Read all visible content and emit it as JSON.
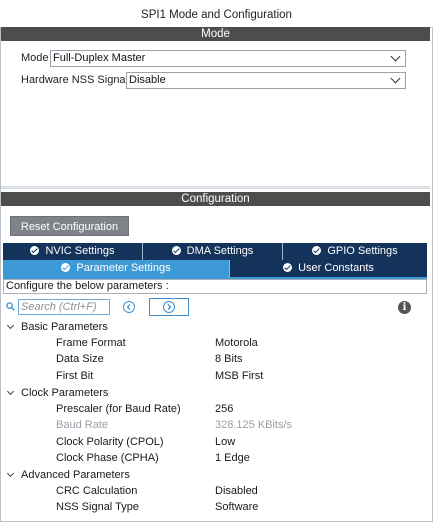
{
  "window": {
    "title": "SPI1 Mode and Configuration"
  },
  "mode_section": {
    "title": "Mode",
    "fields": [
      {
        "label": "Mode",
        "value": "Full-Duplex Master"
      },
      {
        "label": "Hardware NSS Signal",
        "value": "Disable"
      }
    ]
  },
  "config_section": {
    "title": "Configuration",
    "reset_label": "Reset Configuration",
    "tabs": [
      {
        "label": "NVIC Settings",
        "state": "inactive"
      },
      {
        "label": "DMA Settings",
        "state": "inactive"
      },
      {
        "label": "GPIO Settings",
        "state": "inactive"
      },
      {
        "label": "Parameter Settings",
        "state": "active"
      },
      {
        "label": "User Constants",
        "state": "inactive"
      }
    ],
    "hint": "Configure the below parameters :",
    "search": {
      "placeholder": "Search (Ctrl+F)"
    },
    "groups": [
      {
        "name": "Basic Parameters",
        "params": [
          {
            "name": "Frame Format",
            "value": "Motorola"
          },
          {
            "name": "Data Size",
            "value": "8 Bits"
          },
          {
            "name": "First Bit",
            "value": "MSB First"
          }
        ]
      },
      {
        "name": "Clock Parameters",
        "params": [
          {
            "name": "Prescaler (for Baud Rate)",
            "value": "256"
          },
          {
            "name": "Baud Rate",
            "value": "328.125 KBits/s",
            "disabled": true
          },
          {
            "name": "Clock Polarity (CPOL)",
            "value": "Low"
          },
          {
            "name": "Clock Phase (CPHA)",
            "value": "1 Edge"
          }
        ]
      },
      {
        "name": "Advanced Parameters",
        "params": [
          {
            "name": "CRC Calculation",
            "value": "Disabled"
          },
          {
            "name": "NSS Signal Type",
            "value": "Software"
          }
        ]
      }
    ]
  },
  "colors": {
    "section_bar": "#4d4d4d",
    "tab_dark": "#13335a",
    "tab_active": "#3d9ad6",
    "reset_button": "#7f8389"
  },
  "icons": [
    "check-circle-icon",
    "search-icon",
    "arrow-left-circle-icon",
    "arrow-right-circle-icon",
    "info-icon",
    "chevron-down-icon",
    "caret-down-icon"
  ]
}
